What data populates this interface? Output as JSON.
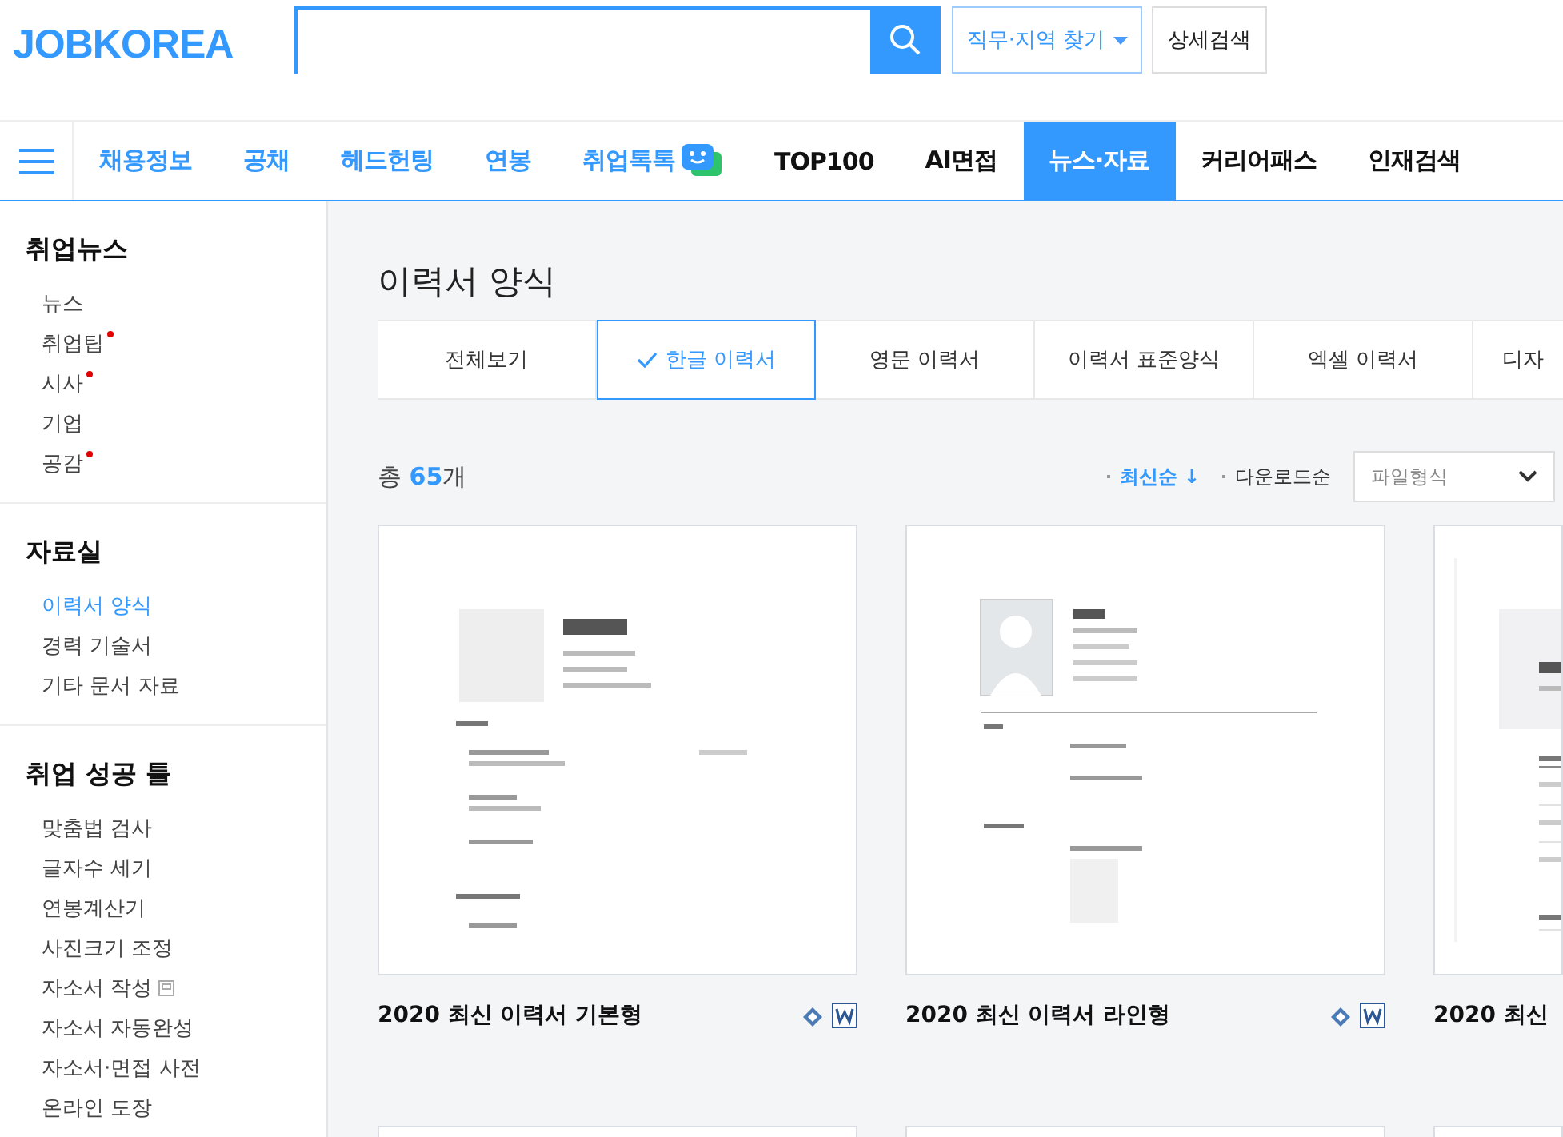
{
  "header": {
    "logo": "JOBKOREA",
    "region_button": "직무·지역 찾기",
    "detail_button": "상세검색"
  },
  "nav": [
    {
      "label": "채용정보",
      "kind": "service",
      "selected": false
    },
    {
      "label": "공채",
      "kind": "service",
      "selected": false
    },
    {
      "label": "헤드헌팅",
      "kind": "service",
      "selected": false
    },
    {
      "label": "연봉",
      "kind": "service",
      "selected": false
    },
    {
      "label": "취업톡톡",
      "kind": "chat",
      "selected": false
    },
    {
      "label": "TOP100",
      "kind": "menu",
      "selected": false
    },
    {
      "label": "AI면접",
      "kind": "menu",
      "selected": false
    },
    {
      "label": "뉴스·자료",
      "kind": "menu",
      "selected": true
    },
    {
      "label": "커리어패스",
      "kind": "menu",
      "selected": false
    },
    {
      "label": "인재검색",
      "kind": "menu",
      "selected": false
    }
  ],
  "sidebar": [
    {
      "title": "취업뉴스",
      "items": [
        {
          "label": "뉴스",
          "selected": false,
          "new": false
        },
        {
          "label": "취업팁",
          "selected": false,
          "new": true
        },
        {
          "label": "시사",
          "selected": false,
          "new": true
        },
        {
          "label": "기업",
          "selected": false,
          "new": false
        },
        {
          "label": "공감",
          "selected": false,
          "new": true
        }
      ]
    },
    {
      "title": "자료실",
      "items": [
        {
          "label": "이력서 양식",
          "selected": true,
          "new": false
        },
        {
          "label": "경력 기술서",
          "selected": false,
          "new": false
        },
        {
          "label": "기타 문서 자료",
          "selected": false,
          "new": false
        }
      ]
    },
    {
      "title": "취업 성공 툴",
      "items": [
        {
          "label": "맞춤법 검사",
          "selected": false,
          "new": false
        },
        {
          "label": "글자수 세기",
          "selected": false,
          "new": false
        },
        {
          "label": "연봉계산기",
          "selected": false,
          "new": false
        },
        {
          "label": "사진크기 조정",
          "selected": false,
          "new": false
        },
        {
          "label": "자소서 작성",
          "selected": false,
          "new": false,
          "external": true
        },
        {
          "label": "자소서 자동완성",
          "selected": false,
          "new": false
        },
        {
          "label": "자소서·면접 사전",
          "selected": false,
          "new": false
        },
        {
          "label": "온라인 도장",
          "selected": false,
          "new": false
        }
      ]
    }
  ],
  "page_title": "이력서 양식",
  "tabs": [
    {
      "label": "전체보기",
      "selected": false
    },
    {
      "label": "한글 이력서",
      "selected": true
    },
    {
      "label": "영문 이력서",
      "selected": false
    },
    {
      "label": "이력서 표준양식",
      "selected": false
    },
    {
      "label": "엑셀 이력서",
      "selected": false
    },
    {
      "label": "디자",
      "selected": false
    }
  ],
  "total": {
    "prefix": "총",
    "count": "65",
    "suffix": "개"
  },
  "sort": [
    {
      "label": "최신순 ↓",
      "selected": true
    },
    {
      "label": "다운로드순",
      "selected": false
    }
  ],
  "file_type": {
    "placeholder": "파일형식"
  },
  "cards": [
    {
      "title": "2020 최신 이력서 기본형",
      "kind": "basic",
      "file_icons": [
        {
          "kind": "hwp"
        },
        {
          "kind": "word"
        }
      ]
    },
    {
      "title": "2020 최신 이력서 라인형",
      "kind": "line",
      "file_icons": [
        {
          "kind": "hwp"
        },
        {
          "kind": "word"
        }
      ]
    },
    {
      "title": "2020 최신",
      "kind": "box"
    }
  ]
}
